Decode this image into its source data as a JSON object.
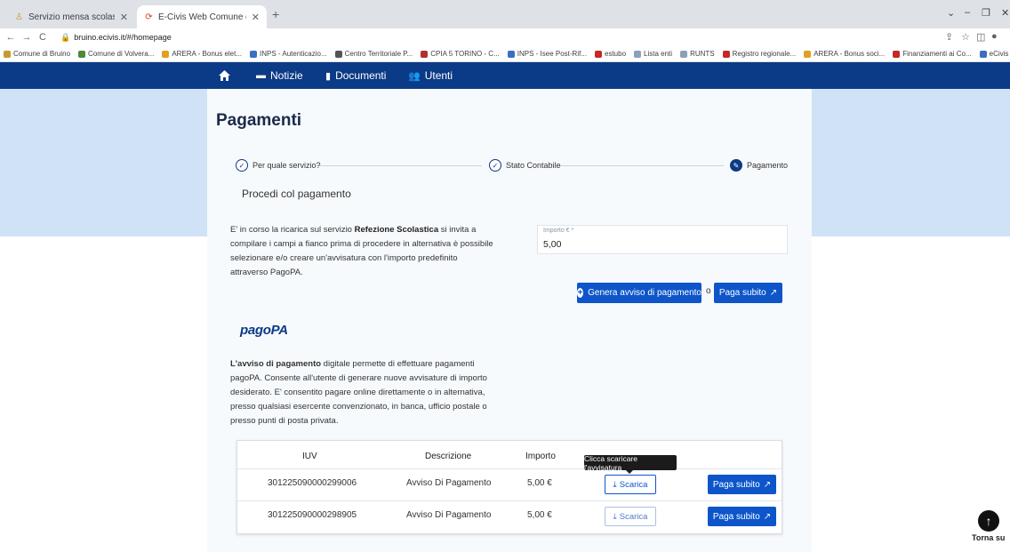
{
  "browser": {
    "tabs": [
      {
        "title": "Servizio mensa scolastica, nuovo",
        "active": false
      },
      {
        "title": "E-Civis Web Comune di Bruino",
        "active": true
      }
    ],
    "new_tab": "+",
    "url": "bruino.ecivis.it/#/homepage",
    "bookmarks": [
      {
        "label": "Comune di Bruino",
        "color": "#c89a2e"
      },
      {
        "label": "Comune di Volvera...",
        "color": "#4a8a3a"
      },
      {
        "label": "ARERA - Bonus elet...",
        "color": "#e0a020"
      },
      {
        "label": "INPS - Autenticazio...",
        "color": "#3a6fc4"
      },
      {
        "label": "Centro Territoriale P...",
        "color": "#555555"
      },
      {
        "label": "CPIA 5 TORINO - C...",
        "color": "#b03030"
      },
      {
        "label": "INPS - Isee Post-Rif...",
        "color": "#3a6fc4"
      },
      {
        "label": "estubo",
        "color": "#c62828"
      },
      {
        "label": "Lista enti",
        "color": "#8aa0b8"
      },
      {
        "label": "RUNTS",
        "color": "#8aa0b8"
      },
      {
        "label": "Registro regionale...",
        "color": "#c62828"
      },
      {
        "label": "ARERA - Bonus soci...",
        "color": "#e0a020"
      },
      {
        "label": "Finanziamenti ai Co...",
        "color": "#c62828"
      },
      {
        "label": "eCivis Solution",
        "color": "#3a6fc4"
      }
    ]
  },
  "nav": {
    "items": [
      {
        "label": "Notizie",
        "icon": "newspaper-icon"
      },
      {
        "label": "Documenti",
        "icon": "document-icon"
      },
      {
        "label": "Utenti",
        "icon": "users-icon"
      }
    ]
  },
  "page": {
    "title": "Pagamenti",
    "steps": [
      {
        "label": "Per quale servizio?",
        "state": "done"
      },
      {
        "label": "Stato Contabile",
        "state": "done"
      },
      {
        "label": "Pagamento",
        "state": "current"
      }
    ],
    "section_heading": "Procedi col pagamento",
    "intro_before": "E' in corso la ricarica sul servizio ",
    "intro_service": "Refezione Scolastica",
    "intro_after": " si invita a compilare i campi a fianco prima di procedere in alternativa è possibile selezionare e/o creare un'avvisatura con l'importo predefinito attraverso PagoPA.",
    "amount_label": "Importo € *",
    "amount_value": "5,00",
    "generate_label": "Genera avviso di pagamento",
    "or_label": "o",
    "pay_now_label": "Paga subito",
    "pagopa_logo": "pagoPA",
    "desc_bold": "L'avviso di pagamento",
    "desc_rest": " digitale permette di effettuare pagamenti pagoPA. Consente all'utente di generare nuove avvisature di importo desiderato. E' consentito pagare online direttamente o in alternativa, presso qualsiasi esercente convenzionato, in banca, ufficio postale o presso punti di posta privata."
  },
  "table": {
    "headers": [
      "IUV",
      "Descrizione",
      "Importo"
    ],
    "rows": [
      {
        "iuv": "301225090000299006",
        "descrizione": "Avviso Di Pagamento",
        "importo": "5,00 €"
      },
      {
        "iuv": "301225090000298905",
        "descrizione": "Avviso Di Pagamento",
        "importo": "5,00 €"
      }
    ],
    "download_label": "Scarica",
    "pay_label": "Paga subito",
    "tooltip": "Clicca scaricare l'avvisatura"
  },
  "back_to_top": "Torna su"
}
